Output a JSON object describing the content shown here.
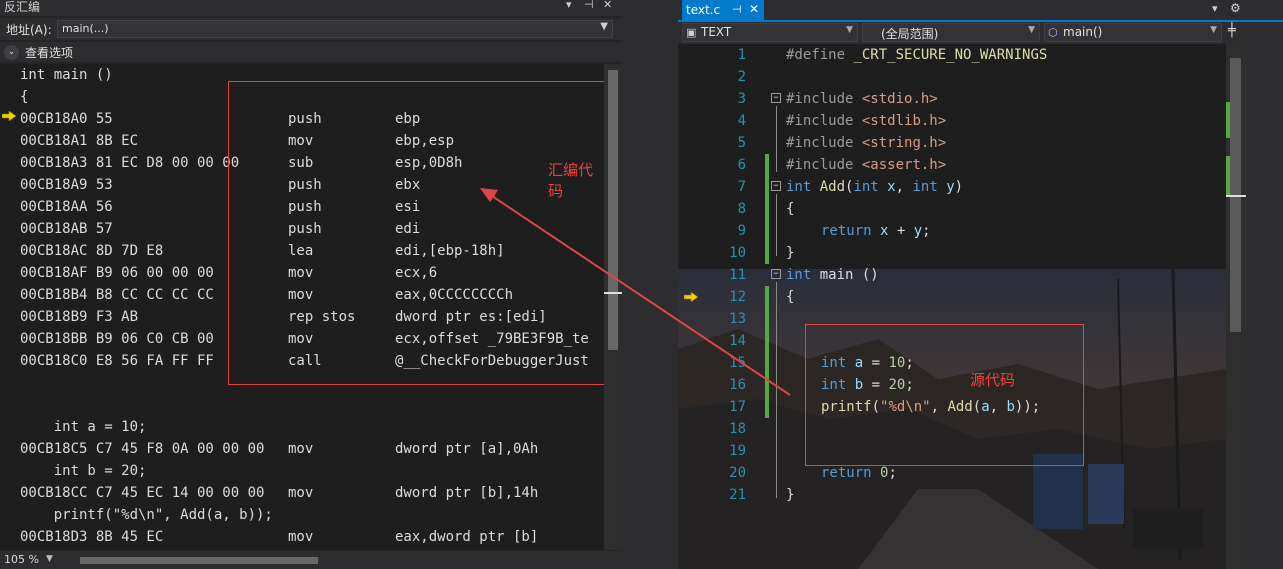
{
  "disassembly": {
    "title": "反汇编",
    "window_controls": [
      "▾",
      "⊣",
      "✕"
    ],
    "address_label": "地址(A):",
    "address_value": "main(...)",
    "view_options_label": "查看选项",
    "zoom": "105 %",
    "annotation": "汇编代码",
    "source_lines": {
      "fn_header": "int main ()",
      "open_brace": "{",
      "stmt_a": "    int a = 10;",
      "stmt_b": "    int b = 20;",
      "stmt_printf": "    printf(\"%d\\n\", Add(a, b));"
    },
    "prologue": [
      {
        "addr": "00CB18A0 55",
        "mnemonic": "push",
        "operand": "ebp"
      },
      {
        "addr": "00CB18A1 8B EC",
        "mnemonic": "mov",
        "operand": "ebp,esp"
      },
      {
        "addr": "00CB18A3 81 EC D8 00 00 00",
        "mnemonic": "sub",
        "operand": "esp,0D8h"
      },
      {
        "addr": "00CB18A9 53",
        "mnemonic": "push",
        "operand": "ebx"
      },
      {
        "addr": "00CB18AA 56",
        "mnemonic": "push",
        "operand": "esi"
      },
      {
        "addr": "00CB18AB 57",
        "mnemonic": "push",
        "operand": "edi"
      },
      {
        "addr": "00CB18AC 8D 7D E8",
        "mnemonic": "lea",
        "operand": "edi,[ebp-18h]"
      },
      {
        "addr": "00CB18AF B9 06 00 00 00",
        "mnemonic": "mov",
        "operand": "ecx,6"
      },
      {
        "addr": "00CB18B4 B8 CC CC CC CC",
        "mnemonic": "mov",
        "operand": "eax,0CCCCCCCCh"
      },
      {
        "addr": "00CB18B9 F3 AB",
        "mnemonic": "rep stos",
        "operand": "dword ptr es:[edi]"
      },
      {
        "addr": "00CB18BB B9 06 C0 CB 00",
        "mnemonic": "mov",
        "operand": "ecx,offset _79BE3F9B_te"
      },
      {
        "addr": "00CB18C0 E8 56 FA FF FF",
        "mnemonic": "call",
        "operand": "@__CheckForDebuggerJust"
      }
    ],
    "body": {
      "a": {
        "addr": "00CB18C5 C7 45 F8 0A 00 00 00",
        "mnemonic": "mov",
        "operand": "dword ptr [a],0Ah"
      },
      "b": {
        "addr": "00CB18CC C7 45 EC 14 00 00 00",
        "mnemonic": "mov",
        "operand": "dword ptr [b],14h"
      },
      "p": {
        "addr": "00CB18D3 8B 45 EC",
        "mnemonic": "mov",
        "operand": "eax,dword ptr [b]"
      }
    }
  },
  "editor": {
    "tab_label": "text.c",
    "tab_pin": "⊣",
    "tab_close": "✕",
    "tab_dropdown": "▾",
    "tab_settings": "⚙",
    "nav_project": "TEXT",
    "nav_scope": "(全局范围)",
    "nav_member": "main()",
    "annotation": "源代码",
    "line_numbers": [
      "1",
      "2",
      "3",
      "4",
      "5",
      "6",
      "7",
      "8",
      "9",
      "10",
      "11",
      "12",
      "13",
      "14",
      "15",
      "16",
      "17",
      "18",
      "19",
      "20",
      "21"
    ],
    "code": {
      "l1_define": "#define",
      "l1_macro": " _CRT_SECURE_NO_WARNINGS",
      "include_kw": "#include",
      "inc3": " <stdio.h>",
      "inc4": " <stdlib.h>",
      "inc5": " <string.h>",
      "inc6": " <assert.h>",
      "kw_int": "int",
      "fn_add": " Add",
      "add_params_open": "(",
      "x_param": " x",
      "comma": ", ",
      "y_param": " y",
      "close_paren": ")",
      "open_brace": "{",
      "close_brace": "}",
      "kw_return": "return",
      "ret_expr_x": " x",
      "ret_expr_plus": " + ",
      "ret_expr_y": "y",
      "semicolon": ";",
      "fn_main": " main ()",
      "var_a": " a",
      "assign": " = ",
      "num_10": "10",
      "var_b": " b",
      "num_20": "20",
      "printf_fn": "printf",
      "printf_open": "(",
      "printf_str": "\"%d\\n\"",
      "printf_comma": ", ",
      "add_call": "Add",
      "add_args_open": "(",
      "arg_a": "a",
      "arg_b": "b",
      "printf_close": "));",
      "num_0": "0"
    }
  },
  "colors": {
    "accent": "#007acc",
    "annotation_red": "#e04545",
    "line_number": "#2b91af",
    "keyword": "#569cd6",
    "change_bar": "#57a64a"
  },
  "icons": {
    "instruction_pointer": "arrow-right-icon",
    "nav_member": "cube-icon",
    "split": "split-icon"
  }
}
